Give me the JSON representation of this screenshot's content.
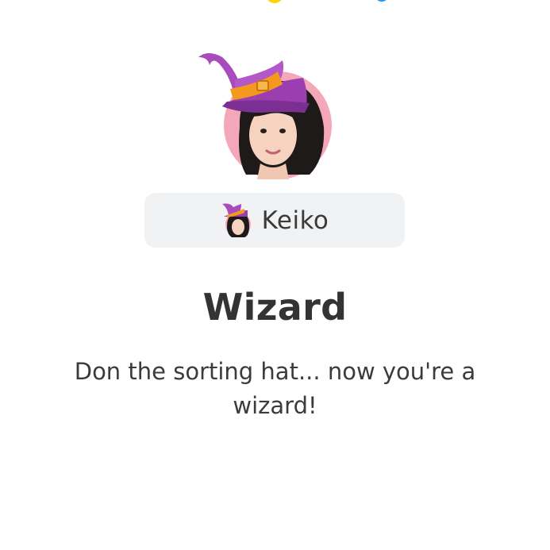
{
  "user": {
    "name": "Keiko"
  },
  "effect": {
    "title": "Wizard",
    "description": "Don the sorting hat... now you're a wizard!",
    "hat_icon": "wizard-hat-icon"
  },
  "colors": {
    "hat_purple": "#9b3fb0",
    "hat_band": "#f39a1e",
    "avatar_bg": "#f4a7b9",
    "chip_bg": "#f1f2f3",
    "title_text": "#333333"
  }
}
